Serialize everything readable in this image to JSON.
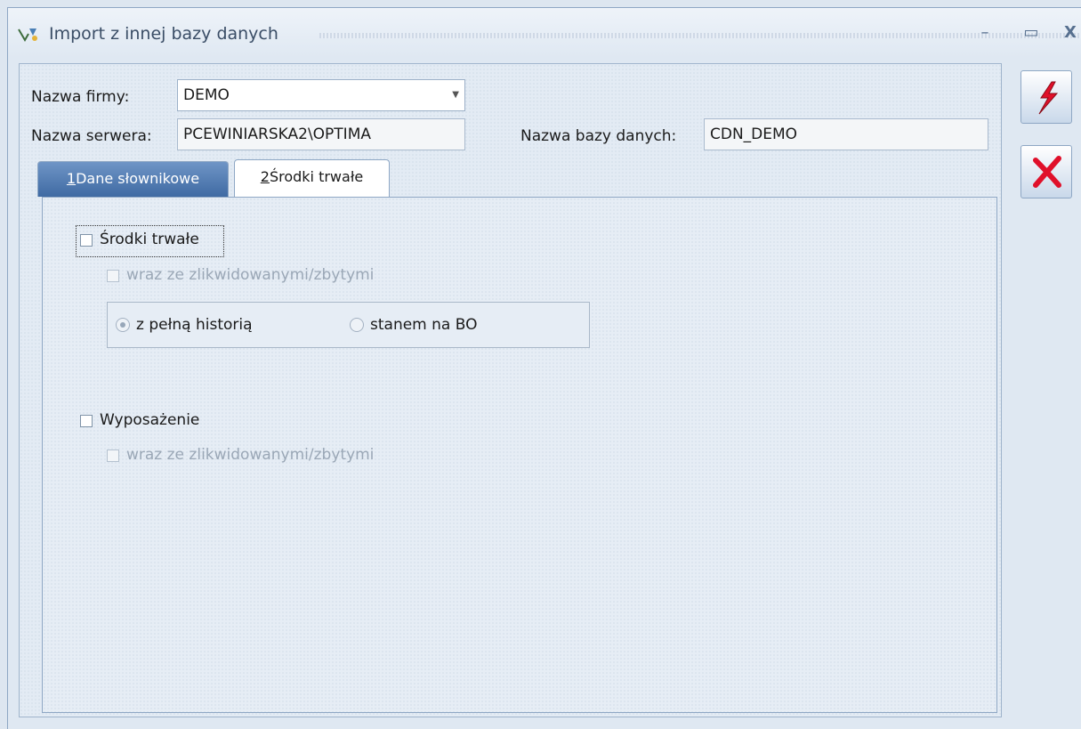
{
  "window": {
    "title": "Import z innej bazy danych",
    "min_icon": "minimize-icon",
    "max_icon": "maximize-icon",
    "close_label": "X"
  },
  "form": {
    "company_label": "Nazwa firmy:",
    "company_value": "DEMO",
    "server_label": "Nazwa serwera:",
    "server_value": "PCEWINIARSKA2\\OPTIMA",
    "database_label": "Nazwa bazy danych:",
    "database_value": "CDN_DEMO"
  },
  "tabs": [
    {
      "num": "1",
      "label": "Dane słownikowe",
      "active": false
    },
    {
      "num": "2",
      "label": "Środki trwałe",
      "active": true
    }
  ],
  "fixed_assets": {
    "checkbox_label": "Środki trwałe",
    "checked": false,
    "with_liquidated_label": "wraz ze zlikwidowanymi/zbytymi",
    "radio_full_history": "z pełną historią",
    "radio_bo_state": "stanem na BO",
    "selected_radio": "z pełną historią"
  },
  "equipment": {
    "checkbox_label": "Wyposażenie",
    "checked": false,
    "with_liquidated_label": "wraz ze zlikwidowanymi/zbytymi"
  },
  "colors": {
    "accent": "#3f6aa3",
    "run_icon": "#e0102a",
    "cancel_icon": "#e0102a"
  },
  "icons": {
    "run": "lightning-icon",
    "cancel": "cancel-x-icon"
  }
}
